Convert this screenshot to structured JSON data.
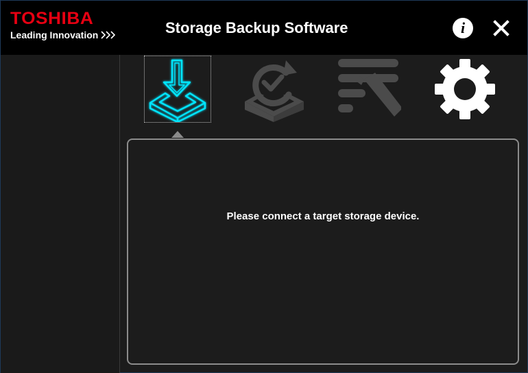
{
  "brand": {
    "name": "TOSHIBA",
    "tagline": "Leading Innovation",
    "color": "#e60012"
  },
  "window": {
    "title": "Storage Backup Software"
  },
  "header": {
    "info_icon": "info-icon",
    "info_glyph": "i",
    "close_icon": "close-icon"
  },
  "toolbar": {
    "items": [
      {
        "name": "backup",
        "icon": "backup-download-icon",
        "selected": true,
        "color": "#00e5ff"
      },
      {
        "name": "restore",
        "icon": "restore-icon",
        "selected": false,
        "color": "#4a4a4a"
      },
      {
        "name": "edit",
        "icon": "edit-list-icon",
        "selected": false,
        "color": "#4a4a4a"
      },
      {
        "name": "settings",
        "icon": "gear-icon",
        "selected": false,
        "color": "#ffffff"
      }
    ]
  },
  "panel": {
    "message": "Please connect a target storage device."
  }
}
